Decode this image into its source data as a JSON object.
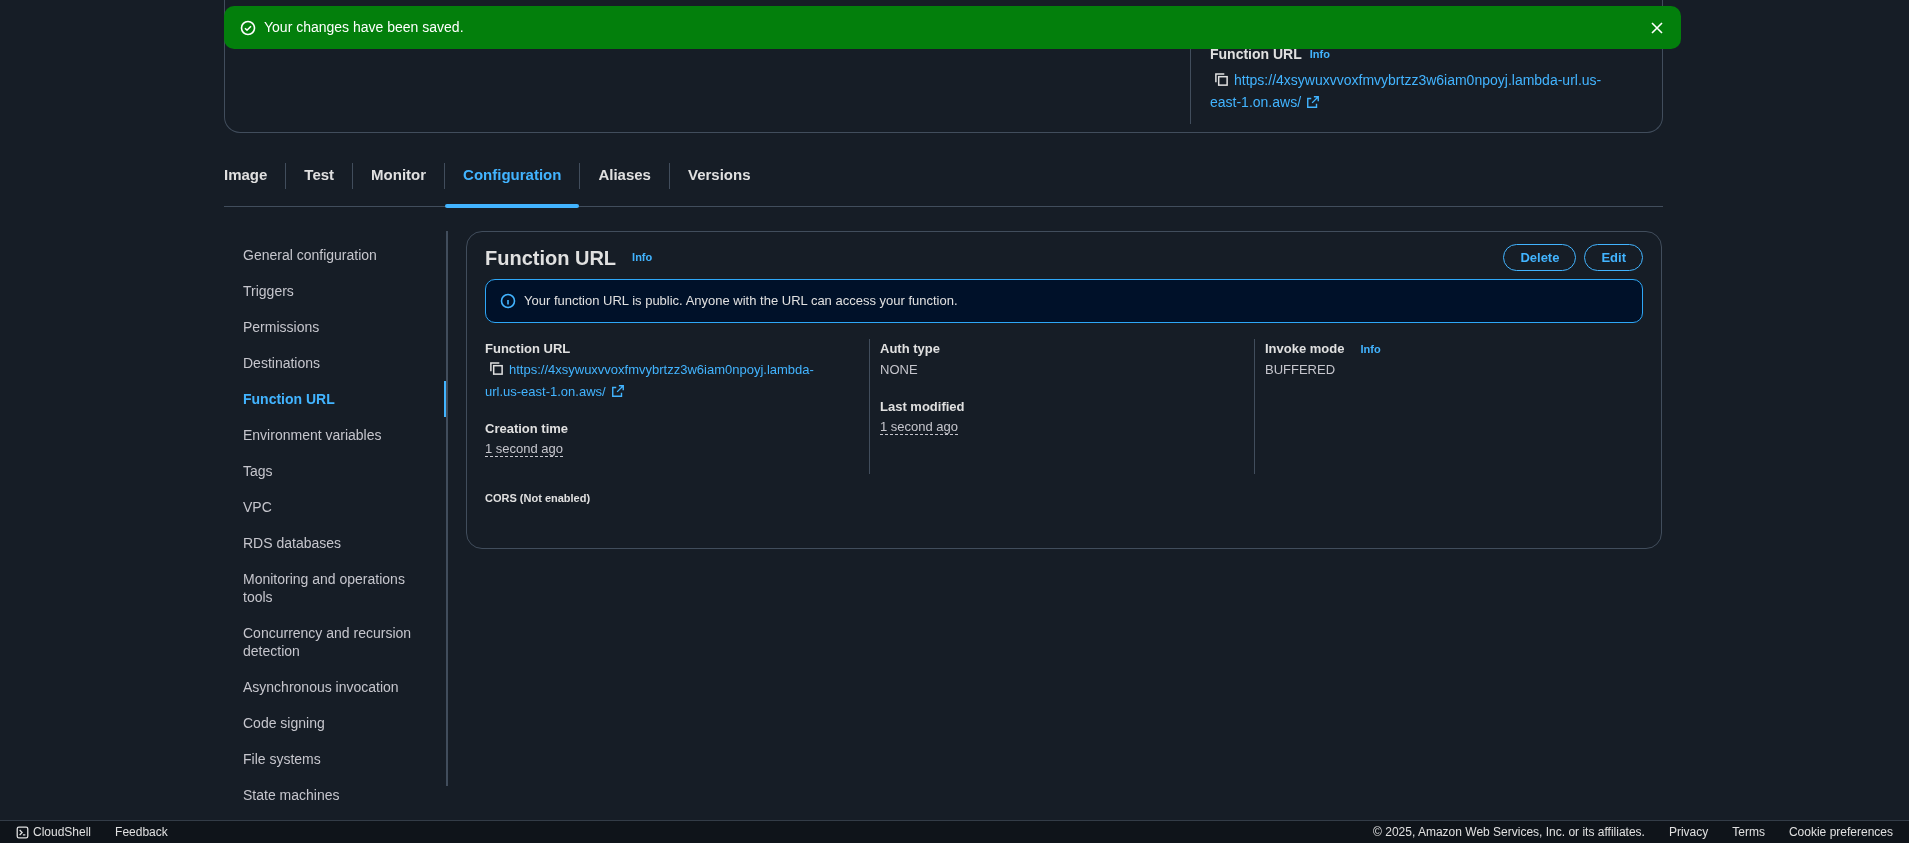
{
  "flash": {
    "message": "Your changes have been saved."
  },
  "summary": {
    "label": "Function URL",
    "info": "Info",
    "url": "https://4xsywuxvvoxfmvybrtzz3w6iam0npoyj.lambda-url.us-east-1.on.aws/"
  },
  "tabs": [
    {
      "label": "Image",
      "selected": false
    },
    {
      "label": "Test",
      "selected": false
    },
    {
      "label": "Monitor",
      "selected": false
    },
    {
      "label": "Configuration",
      "selected": true
    },
    {
      "label": "Aliases",
      "selected": false
    },
    {
      "label": "Versions",
      "selected": false
    }
  ],
  "sidebar": {
    "items": [
      {
        "label": "General configuration",
        "selected": false
      },
      {
        "label": "Triggers",
        "selected": false
      },
      {
        "label": "Permissions",
        "selected": false
      },
      {
        "label": "Destinations",
        "selected": false
      },
      {
        "label": "Function URL",
        "selected": true
      },
      {
        "label": "Environment variables",
        "selected": false
      },
      {
        "label": "Tags",
        "selected": false
      },
      {
        "label": "VPC",
        "selected": false
      },
      {
        "label": "RDS databases",
        "selected": false
      },
      {
        "label": "Monitoring and operations tools",
        "selected": false
      },
      {
        "label": "Concurrency and recursion detection",
        "selected": false
      },
      {
        "label": "Asynchronous invocation",
        "selected": false
      },
      {
        "label": "Code signing",
        "selected": false
      },
      {
        "label": "File systems",
        "selected": false
      },
      {
        "label": "State machines",
        "selected": false
      }
    ]
  },
  "panel": {
    "title": "Function URL",
    "info": "Info",
    "buttons": [
      "Delete",
      "Edit"
    ],
    "alert": "Your function URL is public. Anyone with the URL can access your function.",
    "columns": [
      [
        {
          "label": "Function URL",
          "kind": "link",
          "value": "https://4xsywuxvvoxfmvybrtzz3w6iam0npoyj.lambda-url.us-east-1.on.aws/"
        },
        {
          "label": "Creation time",
          "kind": "time",
          "value": "1 second ago"
        }
      ],
      [
        {
          "label": "Auth type",
          "kind": "text",
          "value": "NONE"
        },
        {
          "label": "Last modified",
          "kind": "time",
          "value": "1 second ago"
        }
      ],
      [
        {
          "label": "Invoke mode",
          "kind": "text",
          "value": "BUFFERED",
          "info": "Info"
        }
      ]
    ],
    "cors": "CORS (Not enabled)"
  },
  "footer": {
    "left": [
      "CloudShell",
      "Feedback"
    ],
    "copyright": "© 2025, Amazon Web Services, Inc. or its affiliates.",
    "links": [
      "Privacy",
      "Terms",
      "Cookie preferences"
    ]
  }
}
